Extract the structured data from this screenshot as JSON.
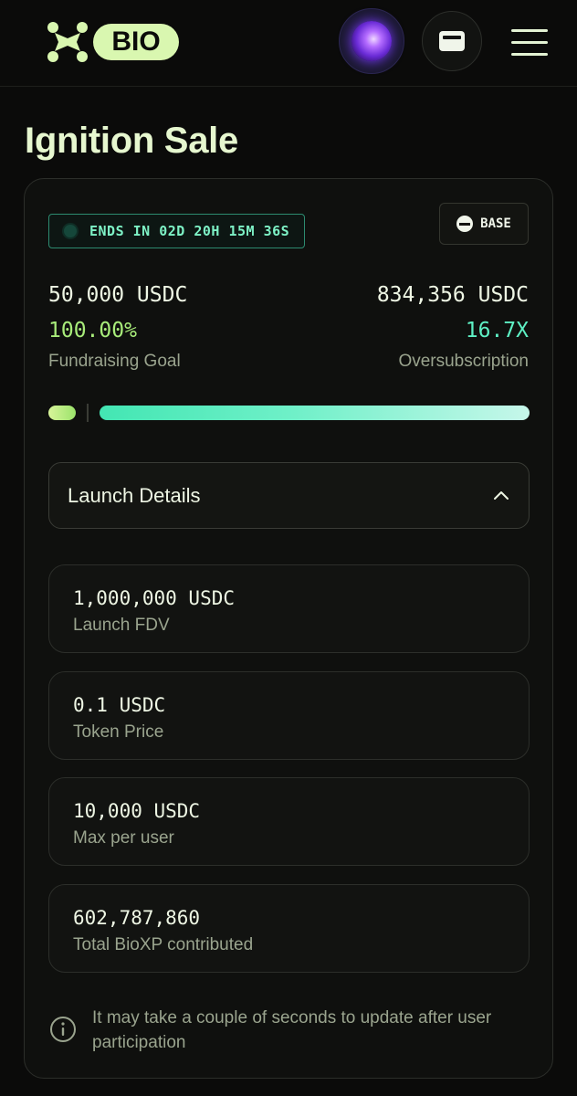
{
  "header": {
    "logo_text": "BIO",
    "icons": {
      "logo": "bio-molecule-logo",
      "avatar": "purple-orb-avatar",
      "wallet": "wallet-icon",
      "menu": "hamburger-menu-icon"
    }
  },
  "page": {
    "title": "Ignition Sale"
  },
  "sale": {
    "countdown": "ENDS IN 02D 20H 15M 36S",
    "chain": "BASE",
    "goal_amount": "50,000 USDC",
    "goal_percent": "100.00%",
    "goal_label": "Fundraising Goal",
    "raised_amount": "834,356 USDC",
    "oversubscription": "16.7X",
    "oversubscription_label": "Oversubscription",
    "progress_goal_fraction": 1.0,
    "oversubscription_multiple": 16.7
  },
  "launch_details": {
    "title": "Launch Details",
    "expanded": true,
    "items": [
      {
        "value": "1,000,000 USDC",
        "label": "Launch FDV"
      },
      {
        "value": "0.1 USDC",
        "label": "Token Price"
      },
      {
        "value": "10,000 USDC",
        "label": "Max per user"
      },
      {
        "value": "602,787,860",
        "label": "Total BioXP contributed"
      }
    ]
  },
  "notice": {
    "text": "It may take a couple of seconds to update after user participation"
  },
  "colors": {
    "background": "#0b0b0a",
    "accent_green": "#a8ec7a",
    "accent_teal": "#5ef0c4",
    "muted_text": "#9aa48e"
  }
}
